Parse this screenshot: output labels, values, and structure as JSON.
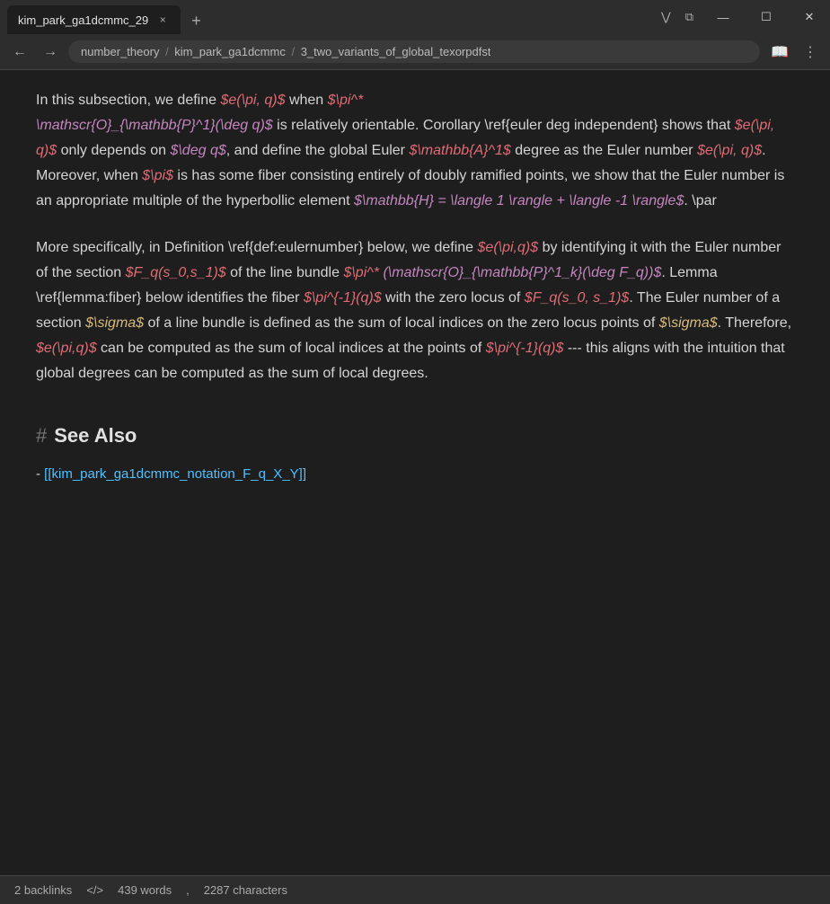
{
  "browser": {
    "tab_title": "kim_park_ga1dcmmc_29",
    "tab_close": "×",
    "new_tab": "+",
    "nav_back": "←",
    "nav_forward": "→",
    "address": {
      "part1": "number_theory",
      "sep1": "/",
      "part2": "kim_park_ga1dcmmc",
      "sep2": "/",
      "part3": "3_two_variants_of_global_texorpdfst"
    },
    "tab_controls": {
      "list": "⋮⋮",
      "minimize_tabs": "⧉",
      "expand": "—",
      "restore": "☐",
      "close": "✕"
    },
    "nav_icons": {
      "bookmark": "📖",
      "menu": "⋮"
    },
    "window_controls": {
      "minimize": "—",
      "restore": "☐",
      "close": "✕"
    }
  },
  "content": {
    "paragraph1": {
      "text_before_e1": "In this subsection, we define ",
      "math_e1": "$e(\\pi,  q)$",
      "text_after_e1": " when ",
      "math_pi_star": "$\\pi^*",
      "math_mathscr": "\\mathscr{O}_{\\mathbb{P}^1}(\\deg q)$",
      "text_after_mathscr": " is relatively orientable.",
      "text_corollary": "Corollary \\ref{euler deg independent} shows that ",
      "math_e2": "$e(\\pi,  q)$",
      "text_only": " only depends on ",
      "math_deg": "$\\deg q$",
      "text_and_define": ", and define the global Euler ",
      "math_A1": "$\\mathbb{A}^1$",
      "text_degree": " degree as the Euler number ",
      "math_e3": "$e(\\pi,  q)$",
      "text_moreover": ". Moreover, when ",
      "math_pi": "$\\pi$",
      "text_is_has": " is has some fiber consisting entirely of doubly ramified points, we show that the Euler number is an appropriate multiple of the hyperbollic element ",
      "math_H": "$\\mathbb{H} = \\langle 1 \\rangle + \\langle -1 \\rangle$",
      "text_par": ". \\par"
    },
    "paragraph2": {
      "text_more": "More specifically, in Definition \\ref{def:eulernumber} below, we define ",
      "math_epi": "$e(\\pi,q)$",
      "text_by_id": " by identifying it with the Euler number of the section ",
      "math_Fq": "$F_q(s\\_0,s\\_1)$",
      "text_of_line": " of the line bundle ",
      "math_pi_star2": "$\\pi^*",
      "math_mathscr2": "(\\mathscr{O}_{\\mathbb{P}^1\\_k}(\\deg F\\_q))$",
      "text_lemma": ". Lemma \\ref{lemma:fiber} below identifies the fiber ",
      "math_pi_inv": "$\\pi^{-1}(q)$",
      "text_with_zero": " with the zero locus of ",
      "math_Fq2": "$F\\_q(s\\_0,  s\\_1)$",
      "text_euler": ". The Euler number of a section ",
      "math_sigma": "$\\sigma$",
      "text_of_line2": " of a line bundle is defined as the sum of local indices on the zero locus points of ",
      "math_sigma2": "$\\sigma$",
      "text_therefore": ". Therefore, ",
      "math_epi2": "$e(\\pi,q)$",
      "text_can_be": " can be computed as the sum of local indices at the points of ",
      "math_pi_inv2": "$\\pi^{-1}(q)$",
      "text_dashes": " --- this aligns with the intuition that global degrees can be computed as the sum of local degrees."
    },
    "section_heading": {
      "hash": "#",
      "title": "See Also"
    },
    "see_also_link": "[[kim_park_ga1dcmmc_notation_F_q_X_Y]]",
    "see_also_prefix": "- "
  },
  "status_bar": {
    "backlinks": "2 backlinks",
    "separator1": "</>",
    "words": "439 words",
    "separator2": ",",
    "characters": "2287 characters"
  }
}
